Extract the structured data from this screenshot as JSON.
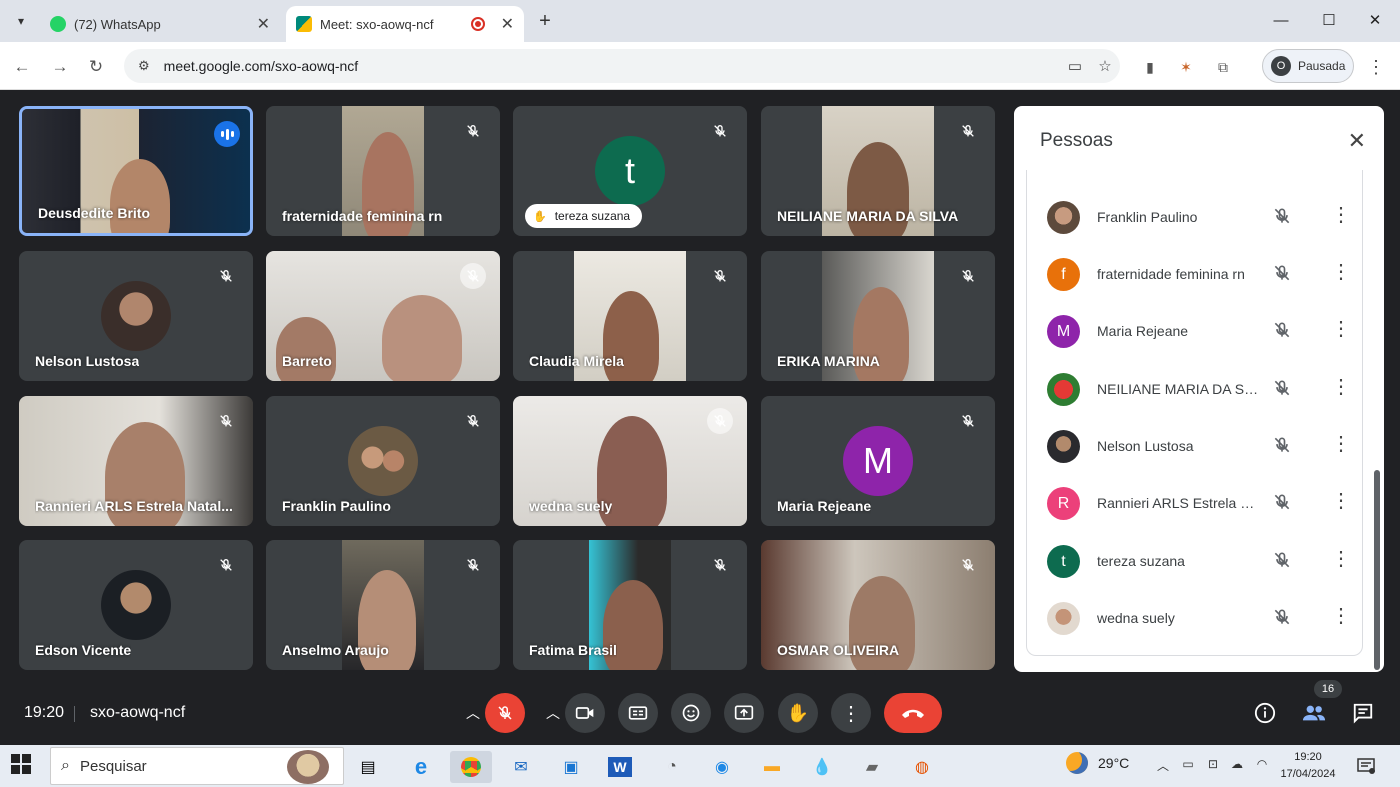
{
  "browser": {
    "tabs": [
      {
        "title": "(72) WhatsApp",
        "favicon": "whatsapp-icon",
        "color": "#25d366"
      },
      {
        "title": "Meet: sxo-aowq-ncf",
        "favicon": "meet-icon",
        "color": "#00897b",
        "recording": true
      }
    ],
    "url": "meet.google.com/sxo-aowq-ncf",
    "profile_initial": "O",
    "profile_label": "Pausada"
  },
  "participants_grid": [
    {
      "name": "Deusdedite Brito",
      "speaking": true
    },
    {
      "name": "fraternidade feminina rn",
      "muted": true
    },
    {
      "name": "tereza suzana",
      "avatar_letter": "t",
      "avatar_color": "#0d6b4f",
      "raised_hand": true
    },
    {
      "name": "NEILIANE MARIA DA SILVA",
      "muted": true
    },
    {
      "name": "Nelson Lustosa",
      "muted": true
    },
    {
      "name": "Barreto",
      "muted": true
    },
    {
      "name": "Claudia Mirela",
      "muted": true
    },
    {
      "name": "ERIKA MARINA",
      "muted": true
    },
    {
      "name": "Rannieri ARLS Estrela Natal...",
      "muted": true
    },
    {
      "name": "Franklin Paulino",
      "muted": true
    },
    {
      "name": "wedna suely",
      "muted": true
    },
    {
      "name": "Maria Rejeane",
      "avatar_letter": "M",
      "avatar_color": "#8e24aa",
      "muted": true
    },
    {
      "name": "Edson Vicente",
      "muted": true
    },
    {
      "name": "Anselmo Araujo",
      "muted": true
    },
    {
      "name": "Fatima Brasil",
      "muted": true
    },
    {
      "name": "OSMAR OLIVEIRA",
      "muted": true
    }
  ],
  "people_panel": {
    "title": "Pessoas",
    "people": [
      {
        "name": "Franklin Paulino",
        "avatar": "photo"
      },
      {
        "name": "fraternidade feminina rn",
        "avatar_letter": "f",
        "avatar_color": "#e8710a"
      },
      {
        "name": "Maria Rejeane",
        "avatar_letter": "M",
        "avatar_color": "#8e24aa"
      },
      {
        "name": "NEILIANE MARIA DA SIL...",
        "avatar": "photo"
      },
      {
        "name": "Nelson Lustosa",
        "avatar": "photo"
      },
      {
        "name": "Rannieri ARLS Estrela N...",
        "avatar_letter": "R",
        "avatar_color": "#ec407a"
      },
      {
        "name": "tereza suzana",
        "avatar_letter": "t",
        "avatar_color": "#0d6b4f"
      },
      {
        "name": "wedna suely",
        "avatar": "photo"
      }
    ]
  },
  "meeting": {
    "time": "19:20",
    "code": "sxo-aowq-ncf",
    "participant_count": "16"
  },
  "taskbar": {
    "search_placeholder": "Pesquisar",
    "temperature": "29°C",
    "time": "19:20",
    "date": "17/04/2024"
  }
}
